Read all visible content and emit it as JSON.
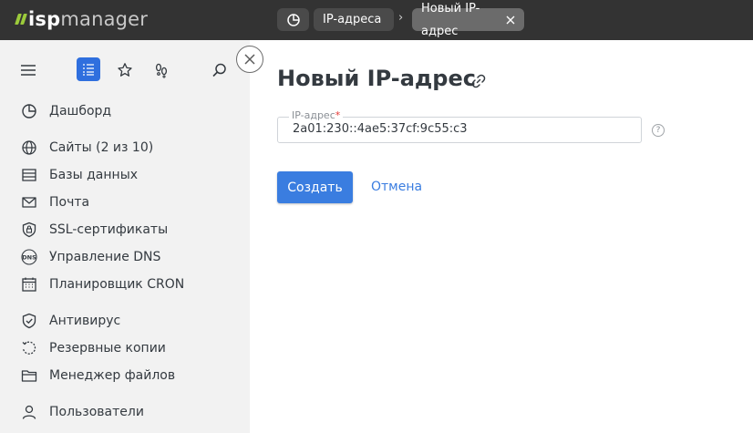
{
  "brand": {
    "name_bold": "isp",
    "name_light": "manager",
    "accent": "#9ccb3b"
  },
  "breadcrumbs": [
    {
      "label": "IP-адреса"
    },
    {
      "label": "Новый IP-адрес"
    }
  ],
  "breadcrumb_separator": "›",
  "sidebar": {
    "tools": [
      "menu-icon",
      "list-icon",
      "star-icon",
      "steps-icon",
      "search-icon"
    ],
    "items": [
      {
        "label": "Дашборд",
        "icon": "dashboard-icon"
      },
      {
        "label": "Сайты (2 из 10)",
        "icon": "globe-icon"
      },
      {
        "label": "Базы данных",
        "icon": "database-icon"
      },
      {
        "label": "Почта",
        "icon": "mail-icon"
      },
      {
        "label": "SSL-сертификаты",
        "icon": "lock-icon"
      },
      {
        "label": "Управление DNS",
        "icon": "dns-icon"
      },
      {
        "label": "Планировщик CRON",
        "icon": "calendar-icon"
      },
      {
        "label": "Антивирус",
        "icon": "shield-icon"
      },
      {
        "label": "Резервные копии",
        "icon": "backup-icon"
      },
      {
        "label": "Менеджер файлов",
        "icon": "folder-icon"
      },
      {
        "label": "Пользователи",
        "icon": "user-icon"
      }
    ]
  },
  "form": {
    "title": "Новый IP-адрес",
    "ip_label": "IP-адрес",
    "ip_required_mark": "*",
    "ip_value": "2a01:230::4ae5:37cf:9c55:c3",
    "help": "?",
    "create_label": "Создать",
    "cancel_label": "Отмена"
  },
  "colors": {
    "primary": "#3a7de0",
    "topbar": "#333333",
    "sidebar": "#f2f2f2"
  }
}
